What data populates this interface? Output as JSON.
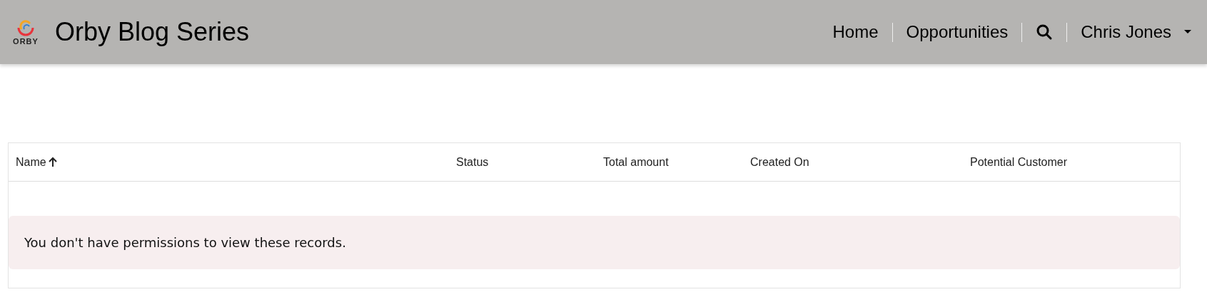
{
  "header": {
    "logo_text": "ORBY",
    "title": "Orby Blog Series",
    "nav": [
      {
        "kind": "link",
        "label": "Home"
      },
      {
        "kind": "link",
        "label": "Opportunities"
      },
      {
        "kind": "search"
      },
      {
        "kind": "menu",
        "label": "Chris Jones"
      }
    ]
  },
  "table": {
    "columns": [
      {
        "label": "Name",
        "sorted_ascending": true
      },
      {
        "label": "Status",
        "sorted_ascending": false
      },
      {
        "label": "Total amount",
        "sorted_ascending": false
      },
      {
        "label": "Created On",
        "sorted_ascending": false
      },
      {
        "label": "Potential Customer",
        "sorted_ascending": false
      }
    ],
    "message": "You don't have permissions to view these records."
  }
}
